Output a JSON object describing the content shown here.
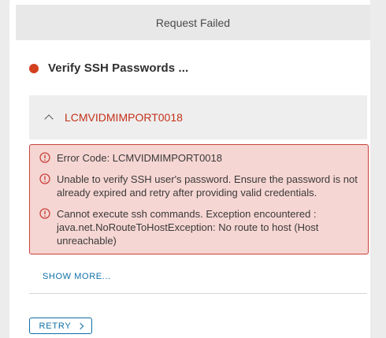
{
  "header": {
    "title": "Request Failed"
  },
  "status": {
    "label": "Verify SSH Passwords ...",
    "color": "#d3401f"
  },
  "accordion": {
    "title": "LCMVIDMIMPORT0018",
    "expanded": true
  },
  "errors": [
    {
      "icon": "error-circle-icon",
      "text": "Error Code: LCMVIDMIMPORT0018"
    },
    {
      "icon": "error-circle-icon",
      "text": "Unable to verify SSH user's password. Ensure the password is not already expired and retry after providing valid credentials."
    },
    {
      "icon": "error-circle-icon",
      "text": "Cannot execute ssh commands. Exception encountered : java.net.NoRouteToHostException: No route to host (Host unreachable)"
    }
  ],
  "actions": {
    "show_more": "SHOW MORE...",
    "retry": "RETRY"
  },
  "colors": {
    "accent": "#0e6fa8",
    "error_bg": "#f6d6d3",
    "error_border": "#c9413a"
  }
}
